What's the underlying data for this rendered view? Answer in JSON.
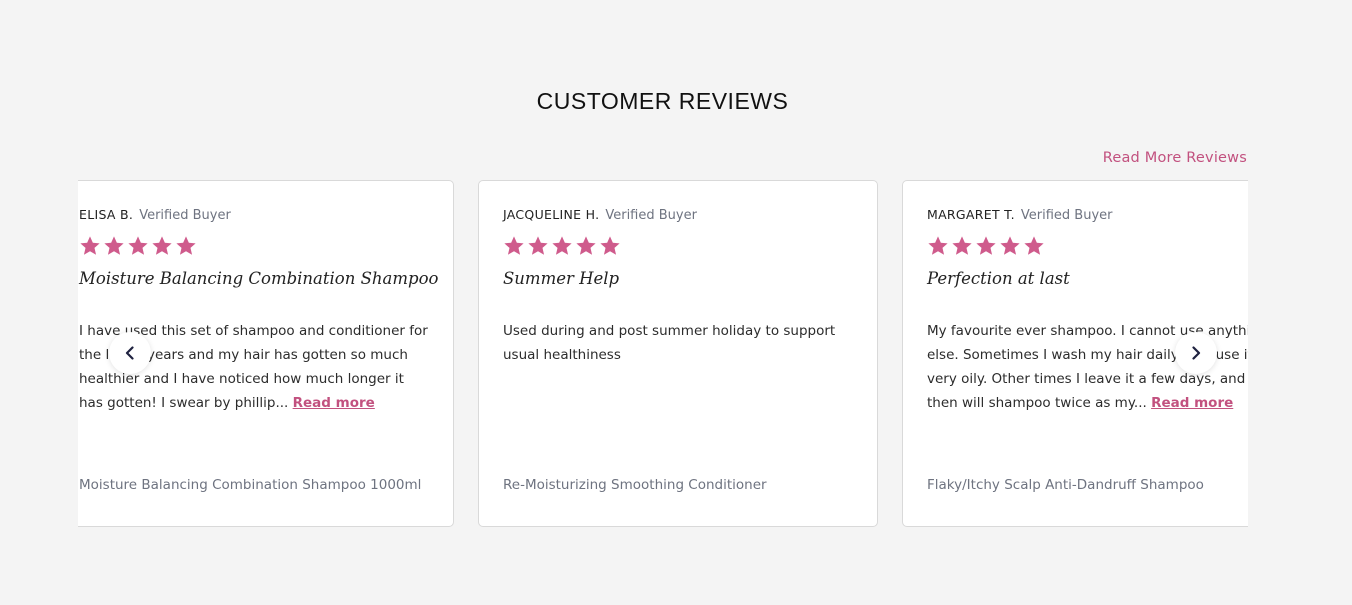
{
  "section": {
    "title": "CUSTOMER REVIEWS",
    "read_more_reviews": "Read More Reviews"
  },
  "colors": {
    "accent": "#c2517f",
    "star": "#cf5b8c",
    "muted": "#6e7380",
    "background": "#f4f4f4"
  },
  "icons": {
    "prev": "chevron-left-icon",
    "next": "chevron-right-icon",
    "star": "star-icon"
  },
  "reviews": [
    {
      "name": "ELISA B.",
      "verified": "Verified Buyer",
      "rating": 5,
      "title": "Moisture Balancing Combination Shampoo",
      "body": "I have used this set of shampoo and conditioner for the last 5 years and my hair has gotten so much healthier and I have noticed how much longer it has gotten! I swear by phillip...",
      "read_more": "Read more",
      "product": "Moisture Balancing Combination Shampoo 1000ml"
    },
    {
      "name": "JACQUELINE H.",
      "verified": "Verified Buyer",
      "rating": 5,
      "title": "Summer Help",
      "body": "Used during and post summer holiday to support usual healthiness",
      "read_more": "",
      "product": "Re-Moisturizing Smoothing Conditioner"
    },
    {
      "name": "MARGARET T.",
      "verified": "Verified Buyer",
      "rating": 5,
      "title": "Perfection at last",
      "body": "My favourite ever shampoo. I cannot use anything else. Sometimes I wash my hair daily because it’s very oily. Other times I leave it a few days, and then will shampoo twice as my...",
      "read_more": "Read more",
      "product": "Flaky/Itchy Scalp Anti-Dandruff Shampoo"
    }
  ]
}
